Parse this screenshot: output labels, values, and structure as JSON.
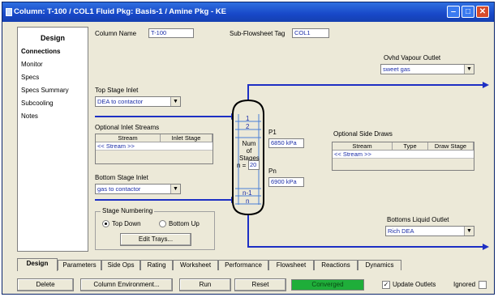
{
  "window": {
    "title": "Column: T-100 / COL1  Fluid Pkg: Basis-1 / Amine Pkg - KE",
    "controls": {
      "minimize": "‒",
      "maximize": "□",
      "close": "✕"
    }
  },
  "sidebar": {
    "header": "Design",
    "items": [
      {
        "label": "Connections",
        "selected": true
      },
      {
        "label": "Monitor"
      },
      {
        "label": "Specs"
      },
      {
        "label": "Specs Summary"
      },
      {
        "label": "Subcooling"
      },
      {
        "label": "Notes"
      }
    ]
  },
  "column_name": {
    "label": "Column Name",
    "value": "T-100"
  },
  "subflowsheet_tag": {
    "label": "Sub-Flowsheet Tag",
    "value": "COL1"
  },
  "ovhd_vapour_outlet": {
    "label": "Ovhd Vapour Outlet",
    "value": "sweet gas"
  },
  "top_stage_inlet": {
    "label": "Top Stage Inlet",
    "value": "DEA to contactor"
  },
  "optional_inlet_streams": {
    "label": "Optional Inlet Streams",
    "headers": [
      "Stream",
      "Inlet Stage"
    ],
    "rows": [
      [
        "<< Stream >>",
        ""
      ]
    ]
  },
  "bottom_stage_inlet": {
    "label": "Bottom Stage Inlet",
    "value": "gas to contactor"
  },
  "stage_numbering": {
    "label": "Stage Numbering",
    "options": [
      "Top Down",
      "Bottom Up"
    ],
    "selected": "Top Down",
    "edit_button": "Edit Trays..."
  },
  "column_diagram": {
    "stages": [
      "1",
      "2",
      "n-1",
      "n"
    ],
    "num_stages_label": "Num of Stages",
    "n_label": "n =",
    "n_value": "20"
  },
  "p1": {
    "label": "P1",
    "value": "6850 kPa"
  },
  "pn": {
    "label": "Pn",
    "value": "6900 kPa"
  },
  "optional_side_draws": {
    "label": "Optional Side Draws",
    "headers": [
      "Stream",
      "Type",
      "Draw Stage"
    ],
    "rows": [
      [
        "<< Stream >>",
        "",
        ""
      ]
    ]
  },
  "bottoms_liquid_outlet": {
    "label": "Bottoms Liquid Outlet",
    "value": "Rich DEA"
  },
  "tabs": [
    "Design",
    "Parameters",
    "Side Ops",
    "Rating",
    "Worksheet",
    "Performance",
    "Flowsheet",
    "Reactions",
    "Dynamics"
  ],
  "active_tab": "Design",
  "bottom_bar": {
    "delete": "Delete",
    "column_environment": "Column Environment...",
    "run": "Run",
    "reset": "Reset",
    "status": "Converged",
    "update_outlets": "Update Outlets",
    "update_outlets_checked": true,
    "ignored": "Ignored",
    "ignored_checked": false
  },
  "colors": {
    "title_bar": "#1848c8",
    "stream_line": "#1d2fc4",
    "status_converged": "#1fae3a",
    "value_text": "#1c2ea8"
  }
}
